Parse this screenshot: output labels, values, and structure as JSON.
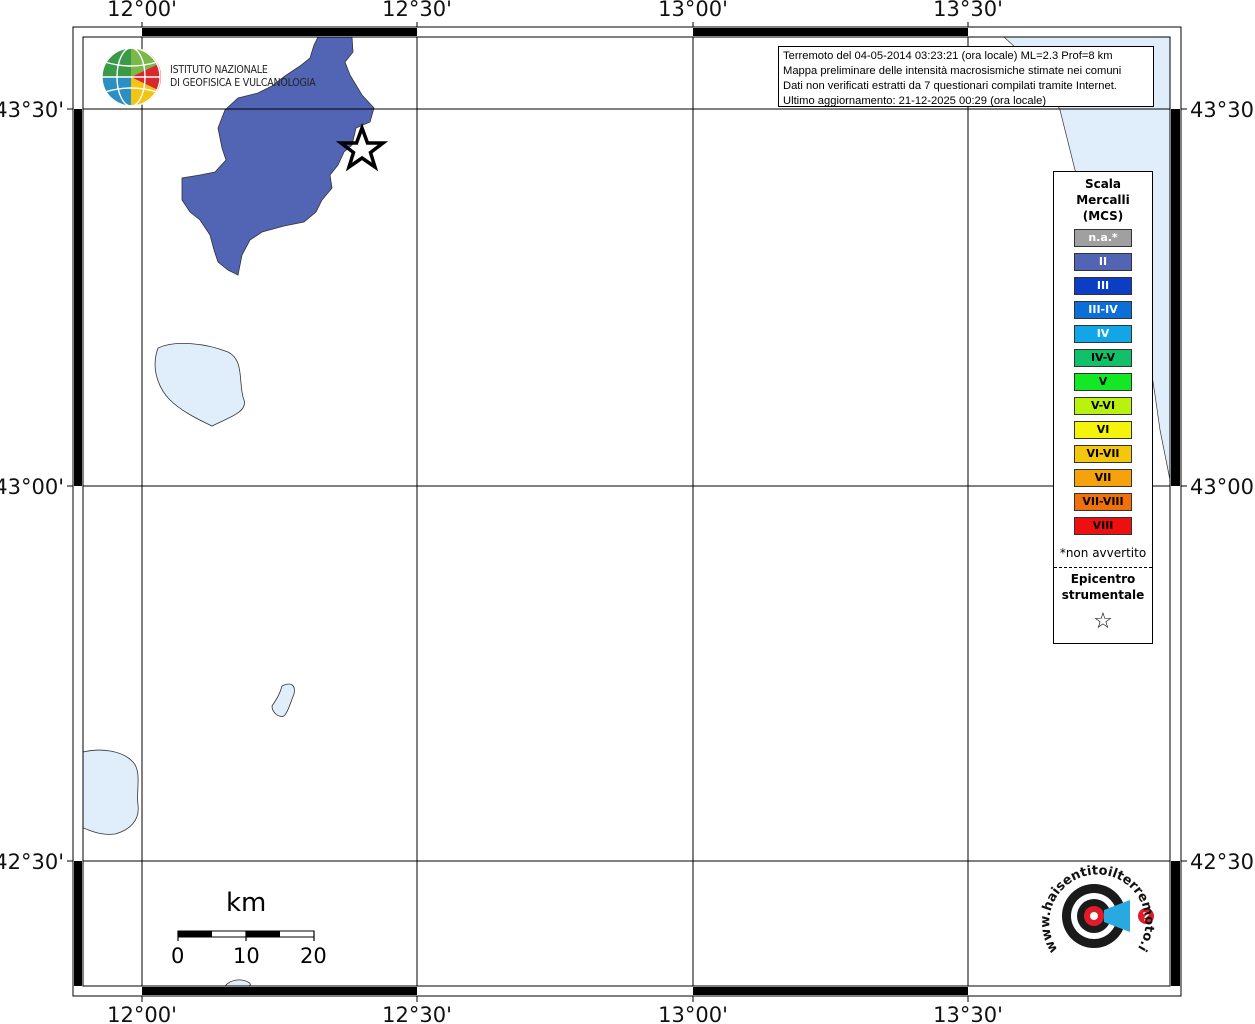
{
  "map": {
    "longitude_labels": [
      "12°00'",
      "12°30'",
      "13°00'",
      "13°30'"
    ],
    "latitude_labels": [
      "43°30'",
      "43°00'",
      "42°30'"
    ]
  },
  "institute": {
    "line1": "ISTITUTO NAZIONALE",
    "line2": "DI GEOFISICA E VULCANOLOGIA"
  },
  "info": {
    "line1": "Terremoto del 04-05-2014 03:23:21 (ora locale) ML=2.3 Prof=8 km",
    "line2": "Mappa preliminare delle intensità macrosismiche stimate nei comuni",
    "line3": "Dati non verificati estratti da 7 questionari compilati tramite Internet.",
    "line4": "Ultimo aggiornamento: 21-12-2025 00:29 (ora locale)"
  },
  "legend": {
    "title_line1": "Scala",
    "title_line2": "Mercalli",
    "title_line3": "(MCS)",
    "items": [
      {
        "label": "n.a.*",
        "color": "#a0a0a0",
        "text_color": "#ffffff"
      },
      {
        "label": "II",
        "color": "#5165b4",
        "text_color": "#ffffff"
      },
      {
        "label": "III",
        "color": "#0b3ec4",
        "text_color": "#ffffff"
      },
      {
        "label": "III-IV",
        "color": "#0c6fd6",
        "text_color": "#ffffff"
      },
      {
        "label": "IV",
        "color": "#12a6e8",
        "text_color": "#ffffff"
      },
      {
        "label": "IV-V",
        "color": "#13c06a",
        "text_color": "#000000"
      },
      {
        "label": "V",
        "color": "#12e824",
        "text_color": "#000000"
      },
      {
        "label": "V-VI",
        "color": "#b8f20d",
        "text_color": "#000000"
      },
      {
        "label": "VI",
        "color": "#f5f20c",
        "text_color": "#000000"
      },
      {
        "label": "VI-VII",
        "color": "#f5c70c",
        "text_color": "#000000"
      },
      {
        "label": "VII",
        "color": "#f5a20c",
        "text_color": "#000000"
      },
      {
        "label": "VII-VIII",
        "color": "#f0700c",
        "text_color": "#000000"
      },
      {
        "label": "VIII",
        "color": "#ec1010",
        "text_color": "#000000"
      }
    ],
    "note": "*non avvertito",
    "epicenter_line1": "Epicentro",
    "epicenter_line2": "strumentale",
    "epicenter_symbol": "☆"
  },
  "scale_bar": {
    "unit": "km",
    "ticks": [
      "0",
      "10",
      "20"
    ]
  },
  "watermark": {
    "text": "www.haisentitoilterremoto.it",
    "icon": "hai-sentito-il-terremoto-logo"
  },
  "colors": {
    "water": "#dfeefa",
    "intensity_area": "#5165b4",
    "grid": "#000000"
  }
}
